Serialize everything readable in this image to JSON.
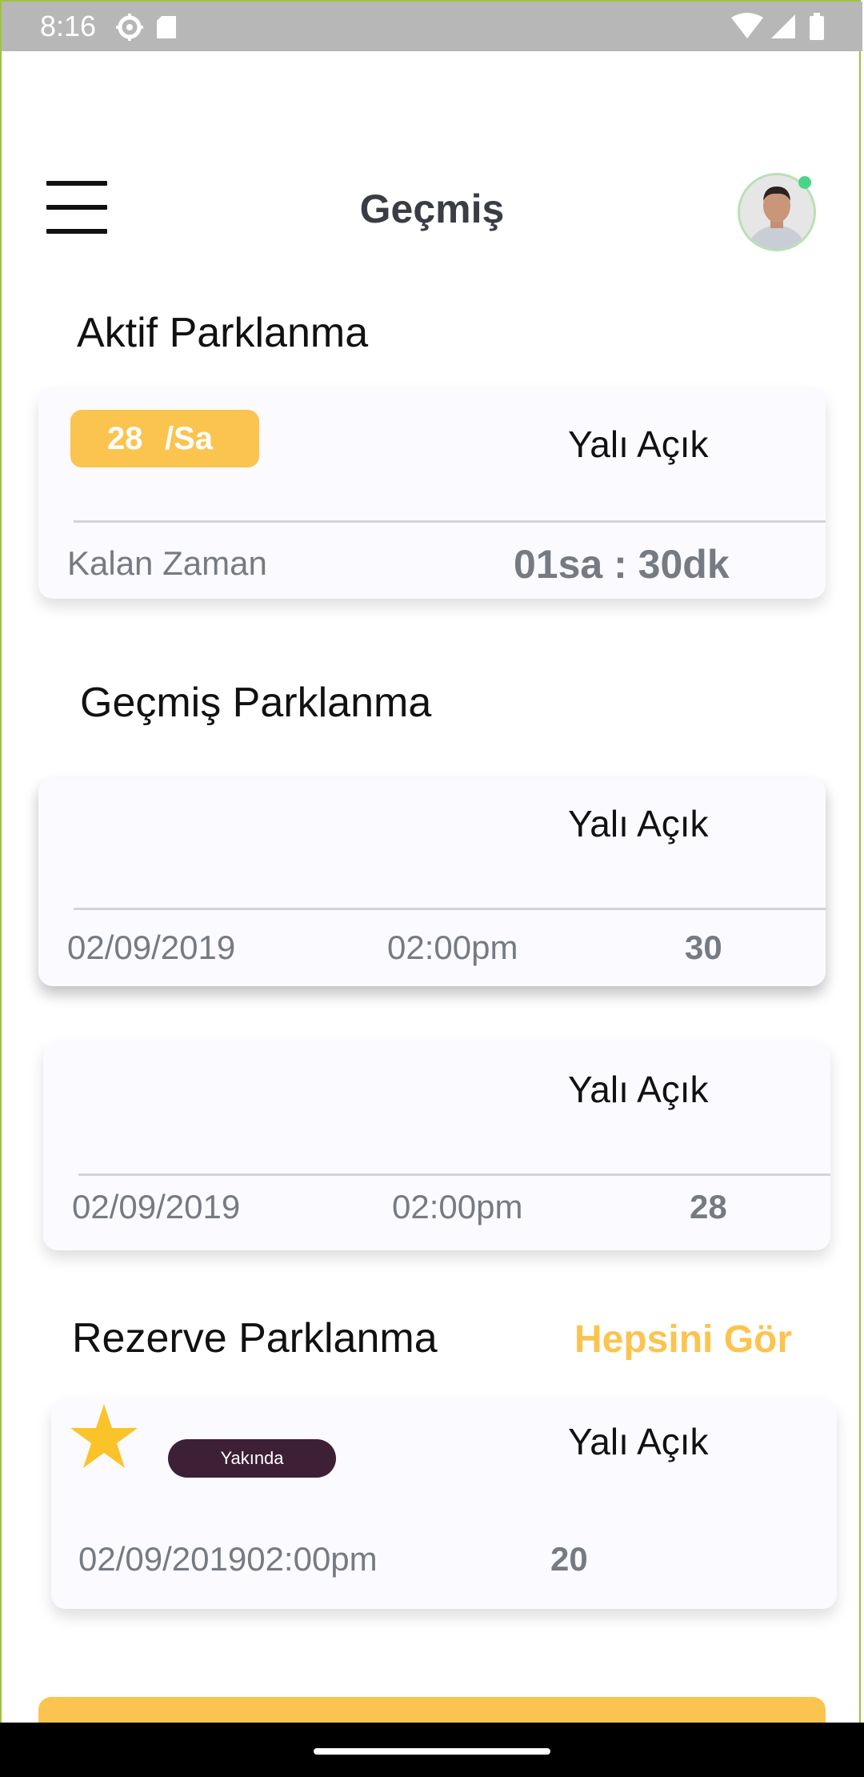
{
  "status_bar": {
    "time": "8:16"
  },
  "header": {
    "title": "Geçmiş"
  },
  "active_section": {
    "title": "Aktif Parklanma",
    "card": {
      "rate_value": "28",
      "rate_unit": "/Sa",
      "place": "Yalı Açık",
      "remaining_label": "Kalan Zaman",
      "remaining_value": "01sa : 30dk"
    }
  },
  "history_section": {
    "title": "Geçmiş Parklanma",
    "cards": [
      {
        "place": "Yalı Açık",
        "date": "02/09/2019",
        "time": "02:00pm",
        "amount": "30"
      },
      {
        "place": "Yalı Açık",
        "date": "02/09/2019",
        "time": "02:00pm",
        "amount": "28"
      }
    ]
  },
  "reserve_section": {
    "title": "Rezerve Parklanma",
    "see_all": "Hepsini Gör",
    "card": {
      "badge": "Yakında",
      "place": "Yalı Açık",
      "datetime": "02/09/201902:00pm",
      "amount": "20"
    }
  },
  "colors": {
    "accent": "#fbc44f",
    "badge_dark": "#3d1f36",
    "title_text": "#3a3d45",
    "muted_text": "#767a83",
    "status_bar": "#b7b7b7"
  },
  "icons": [
    "menu-icon",
    "avatar",
    "settings-icon",
    "sd-card-icon",
    "wifi-icon",
    "signal-icon",
    "battery-icon",
    "star-icon"
  ]
}
